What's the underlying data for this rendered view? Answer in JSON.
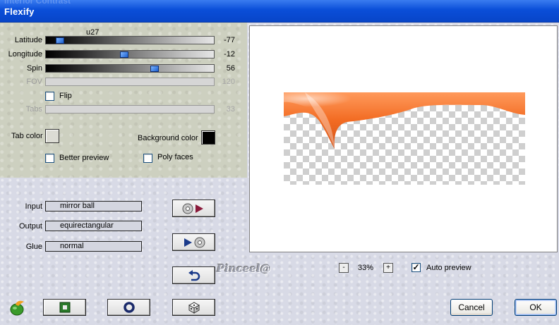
{
  "window": {
    "title": "Flexify",
    "ghost_title": "Interior Contrast"
  },
  "sliders": {
    "overlay_label": "u27",
    "latitude": {
      "label": "Latitude",
      "value": "-77",
      "level": 0.11
    },
    "longitude": {
      "label": "Longitude",
      "value": "-12",
      "level": 0.46
    },
    "spin": {
      "label": "Spin",
      "value": "56",
      "level": 0.64
    },
    "fov": {
      "label": "FOV",
      "value": "120"
    },
    "tabs": {
      "label": "Tabs",
      "value": "33"
    }
  },
  "options": {
    "flip": "Flip",
    "tab_color": "Tab color",
    "background_color": "Background color",
    "better_preview": "Better preview",
    "poly_faces": "Poly faces"
  },
  "colors": {
    "tab_color": "#dcdcd4",
    "background_color": "#000000",
    "preview_tint": "#f26b22"
  },
  "projection": {
    "input_label": "Input",
    "input_value": "mirror ball",
    "output_label": "Output",
    "output_value": "equirectangular",
    "glue_label": "Glue",
    "glue_value": "normal"
  },
  "icons": {
    "convert_forward": "cd-arrow-icon",
    "convert_back": "arrow-cd-icon",
    "undo": "undo-arrow-icon",
    "logo": "flaming-pear-icon",
    "frame": "square-frame-icon",
    "ring": "ring-icon",
    "dice": "dice-icon"
  },
  "zoom": {
    "minus": "-",
    "value": "33%",
    "plus": "+"
  },
  "auto_preview": {
    "label": "Auto preview",
    "checked": true
  },
  "watermark": "Pinceel@",
  "buttons": {
    "cancel": "Cancel",
    "ok": "OK"
  }
}
